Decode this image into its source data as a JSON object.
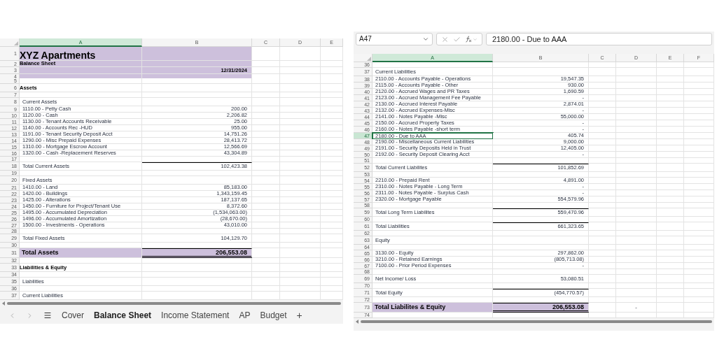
{
  "left_sheet": {
    "columns": [
      {
        "label": "A",
        "selected": true
      },
      {
        "label": "B",
        "selected": false
      },
      {
        "label": "C",
        "selected": false
      },
      {
        "label": "D",
        "selected": false
      },
      {
        "label": "E",
        "selected": false
      }
    ],
    "rows": [
      {
        "number": "1",
        "kind": "title",
        "a": "XYZ Apartments"
      },
      {
        "number": "2",
        "kind": "subtitle",
        "a": "Balance Sheet"
      },
      {
        "number": "3",
        "kind": "date",
        "b": "12/31/2024"
      },
      {
        "number": "4",
        "kind": "band"
      },
      {
        "number": "5",
        "kind": "blank"
      },
      {
        "number": "6",
        "kind": "section",
        "a": "Assets"
      },
      {
        "number": "7",
        "kind": "blank"
      },
      {
        "number": "8",
        "kind": "label",
        "a": "Current Assets"
      },
      {
        "number": "9",
        "kind": "item",
        "a": "1110.00 - Petty Cash",
        "b": "200.00"
      },
      {
        "number": "10",
        "kind": "item",
        "a": "1120.00 - Cash",
        "b": "2,206.82"
      },
      {
        "number": "11",
        "kind": "item",
        "a": "1130.00 - Tenant Accounts Receivable",
        "b": "25.00"
      },
      {
        "number": "12",
        "kind": "item",
        "a": "1140.00 - Accounts Rec -HUD",
        "b": "955.00"
      },
      {
        "number": "13",
        "kind": "item",
        "a": "1191.00 - Tenant Security Deposit Acct",
        "b": "14,751.26"
      },
      {
        "number": "14",
        "kind": "item",
        "a": "1290.00 - Misc Prepaid Expenses",
        "b": "28,413.72"
      },
      {
        "number": "15",
        "kind": "item",
        "a": "1310.00 - Mortgage Escrow Account",
        "b": "12,566.69"
      },
      {
        "number": "16",
        "kind": "item",
        "a": "1320.00 - Cash -Replacement Reserves",
        "b": "43,304.89"
      },
      {
        "number": "17",
        "kind": "blank"
      },
      {
        "number": "18",
        "kind": "total",
        "a": "Total Current Assets",
        "b": "102,423.38"
      },
      {
        "number": "19",
        "kind": "blank"
      },
      {
        "number": "20",
        "kind": "label",
        "a": "Fixed Assets"
      },
      {
        "number": "21",
        "kind": "item",
        "a": "1410.00 - Land",
        "b": "85,183.00"
      },
      {
        "number": "22",
        "kind": "item",
        "a": "1420.00 - Buildings",
        "b": "1,343,159.45"
      },
      {
        "number": "23",
        "kind": "item",
        "a": "1425.00 - Alterations",
        "b": "187,137.65"
      },
      {
        "number": "24",
        "kind": "item",
        "a": "1450.00 - Furniture for Project/Tenant Use",
        "b": "8,372.60"
      },
      {
        "number": "25",
        "kind": "item",
        "a": "1495.00 - Accumulated Depreciation",
        "b": "(1,534,063.00)"
      },
      {
        "number": "26",
        "kind": "item",
        "a": "1496.00 - Accumulated Amortization",
        "b": "(28,670.00)"
      },
      {
        "number": "27",
        "kind": "item",
        "a": "1500.00 - Investments - Operations",
        "b": "43,010.00"
      },
      {
        "number": "28",
        "kind": "blank"
      },
      {
        "number": "29",
        "kind": "label",
        "a": "Total Fixed Assets",
        "b": "104,129.70"
      },
      {
        "number": "30",
        "kind": "blank"
      },
      {
        "number": "31",
        "kind": "grand",
        "a": "Total Assets",
        "b": "206,553.08"
      },
      {
        "number": "32",
        "kind": "blank"
      },
      {
        "number": "33",
        "kind": "section",
        "a": "Liabilities & Equity"
      },
      {
        "number": "34",
        "kind": "blank"
      },
      {
        "number": "35",
        "kind": "label",
        "a": "Liabilities"
      },
      {
        "number": "36",
        "kind": "blank"
      },
      {
        "number": "37",
        "kind": "label",
        "a": "Current Liabilities"
      }
    ]
  },
  "sheet_tabs": {
    "tabs": [
      {
        "label": "Cover",
        "selected": false
      },
      {
        "label": "Balance Sheet",
        "selected": true
      },
      {
        "label": "Income Statement",
        "selected": false
      },
      {
        "label": "AP",
        "selected": false
      },
      {
        "label": "Budget",
        "selected": false
      }
    ],
    "add": "+"
  },
  "right_sheet": {
    "name_box": "A47",
    "formula": "2180.00 - Due to AAA",
    "columns": [
      {
        "label": "A",
        "selected": true
      },
      {
        "label": "B",
        "selected": false
      },
      {
        "label": "C",
        "selected": false
      },
      {
        "label": "D",
        "selected": false
      },
      {
        "label": "E",
        "selected": false
      },
      {
        "label": "F",
        "selected": false
      }
    ],
    "rows": [
      {
        "number": "36",
        "kind": "blank",
        "selected": false
      },
      {
        "number": "37",
        "kind": "label",
        "a": "Current Liabilities",
        "selected": false
      },
      {
        "number": "38",
        "kind": "item",
        "a": "2110.00 - Accounts Payable - Operations",
        "b": "19,547.35",
        "selected": false
      },
      {
        "number": "39",
        "kind": "item",
        "a": "2115.00 - Accounts Payable - Other",
        "b": "930.00",
        "selected": false
      },
      {
        "number": "40",
        "kind": "item",
        "a": "2120.00 - Accrued Wages and PR Taxes",
        "b": "1,690.59",
        "selected": false
      },
      {
        "number": "41",
        "kind": "item",
        "a": "2123.00 - Accrued Management Fee Payable",
        "b": "-",
        "selected": false
      },
      {
        "number": "42",
        "kind": "item",
        "a": "2130.00 - Accrued Interest Payable",
        "b": "2,874.01",
        "selected": false
      },
      {
        "number": "43",
        "kind": "item",
        "a": "2132.00 - Accrued Expenses-Misc",
        "b": "-",
        "selected": false
      },
      {
        "number": "44",
        "kind": "item",
        "a": "2141.00 - Notes Payable -Misc",
        "b": "55,000.00",
        "selected": false
      },
      {
        "number": "45",
        "kind": "item",
        "a": "2150.00 - Accrued Property Taxes",
        "b": "-",
        "selected": false
      },
      {
        "number": "46",
        "kind": "item",
        "a": "2160.00 - Notes Payable -short term",
        "b": "-",
        "selected": false
      },
      {
        "number": "47",
        "kind": "item",
        "a": "2180.00 - Due to AAA",
        "b": "405.74",
        "selected": true
      },
      {
        "number": "48",
        "kind": "item",
        "a": "2190.00 - Miscellaneous Current Liabilities",
        "b": "9,000.00",
        "selected": false
      },
      {
        "number": "49",
        "kind": "item",
        "a": "2191.00 - Security Deposits Held in Trust",
        "b": "12,405.00",
        "selected": false
      },
      {
        "number": "50",
        "kind": "item",
        "a": "2192.00 - Security Deposit Clearing Acct",
        "b": "-",
        "selected": false
      },
      {
        "number": "51",
        "kind": "blank",
        "selected": false
      },
      {
        "number": "52",
        "kind": "total",
        "a": "Total Current Liabilites",
        "b": "101,852.69",
        "selected": false
      },
      {
        "number": "53",
        "kind": "blank",
        "selected": false
      },
      {
        "number": "54",
        "kind": "item",
        "a": "2210.00 - Prepaid Rent",
        "b": "4,891.00",
        "selected": false
      },
      {
        "number": "55",
        "kind": "item",
        "a": "2310.00 - Notes Payable - Long Term",
        "b": "-",
        "selected": false
      },
      {
        "number": "56",
        "kind": "item",
        "a": "2311.00 - Notes Payable - Surplus Cash",
        "b": "-",
        "selected": false
      },
      {
        "number": "57",
        "kind": "item",
        "a": "2320.00 - Mortgage Payable",
        "b": "554,579.96",
        "selected": false
      },
      {
        "number": "58",
        "kind": "blank",
        "selected": false
      },
      {
        "number": "59",
        "kind": "total",
        "a": "Total Long Term Liabilites",
        "b": "559,470.96",
        "selected": false
      },
      {
        "number": "60",
        "kind": "blank",
        "selected": false
      },
      {
        "number": "61",
        "kind": "total",
        "a": "Total Liabilities",
        "b": "661,323.65",
        "selected": false
      },
      {
        "number": "62",
        "kind": "blank",
        "selected": false
      },
      {
        "number": "63",
        "kind": "label",
        "a": "Equity",
        "selected": false
      },
      {
        "number": "64",
        "kind": "blank",
        "selected": false
      },
      {
        "number": "65",
        "kind": "item",
        "a": "3130.00 - Equity",
        "b": "297,862.00",
        "selected": false
      },
      {
        "number": "66",
        "kind": "item",
        "a": "3210.00 - Retained Earnings",
        "b": "(805,713.08)",
        "selected": false
      },
      {
        "number": "67",
        "kind": "item",
        "a": "7100.00 - Prior Period Expenses",
        "b": "-",
        "selected": false
      },
      {
        "number": "68",
        "kind": "blank",
        "selected": false
      },
      {
        "number": "69",
        "kind": "label",
        "a": "Net Income/ Loss",
        "b": "53,080.51",
        "selected": false
      },
      {
        "number": "70",
        "kind": "blank",
        "selected": false
      },
      {
        "number": "71",
        "kind": "total",
        "a": "Total Equity",
        "b": "(454,770.57)",
        "selected": false
      },
      {
        "number": "72",
        "kind": "blank",
        "selected": false
      },
      {
        "number": "73",
        "kind": "grand",
        "a": "Total Liabilites & Equity",
        "b": "206,553.08",
        "d": "-",
        "selected": false
      },
      {
        "number": "74",
        "kind": "blank",
        "selected": false
      }
    ]
  }
}
